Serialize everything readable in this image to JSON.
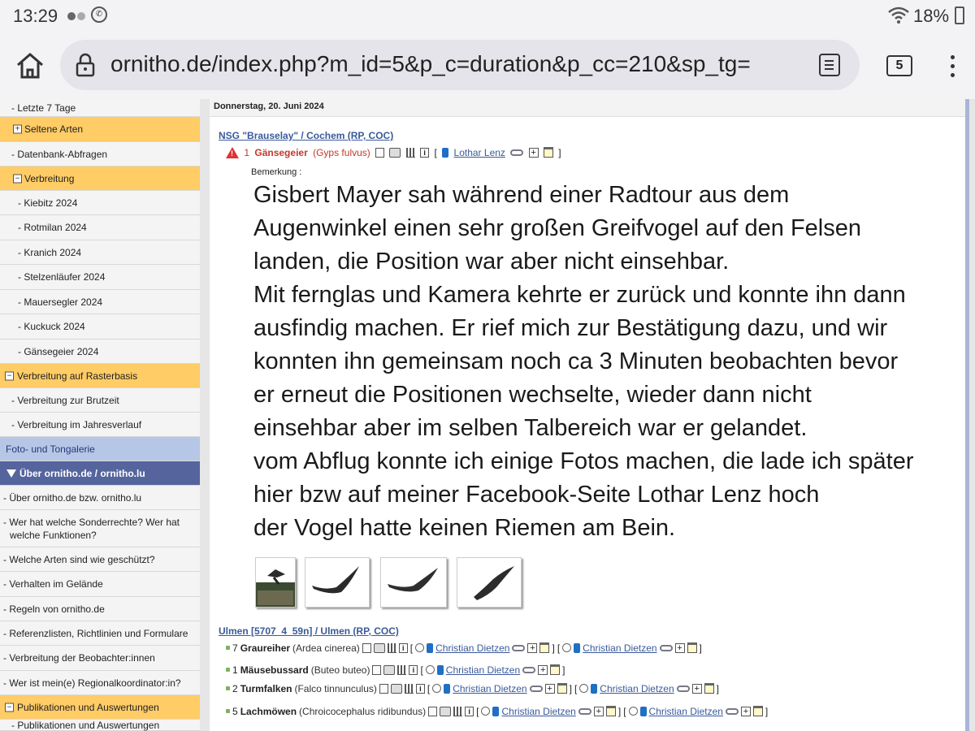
{
  "status": {
    "time": "13:29",
    "battery": "18%",
    "whatsapp_icon": "whatsapp-icon"
  },
  "browser": {
    "url": "ornitho.de/index.php?m_id=5&p_c=duration&p_cc=210&sp_tg=",
    "tab_count": "5"
  },
  "sidebar": {
    "items": [
      {
        "label": "- Letzte 7 Tage",
        "type": "sub"
      },
      {
        "label": "Seltene Arten",
        "type": "cat",
        "box": "+"
      },
      {
        "label": "- Datenbank-Abfragen",
        "type": "sub"
      },
      {
        "label": "Verbreitung",
        "type": "cat",
        "box": "−"
      },
      {
        "label": "- Kiebitz 2024",
        "type": "sub2"
      },
      {
        "label": "- Rotmilan 2024",
        "type": "sub2"
      },
      {
        "label": "- Kranich 2024",
        "type": "sub2"
      },
      {
        "label": "- Stelzenläufer 2024",
        "type": "sub2"
      },
      {
        "label": "- Mauersegler 2024",
        "type": "sub2"
      },
      {
        "label": "- Kuckuck 2024",
        "type": "sub2"
      },
      {
        "label": "- Gänsegeier 2024",
        "type": "sub2"
      },
      {
        "label": "Verbreitung auf Rasterbasis",
        "type": "cat0",
        "box": "−"
      },
      {
        "label": "- Verbreitung zur Brutzeit",
        "type": "sub"
      },
      {
        "label": "- Verbreitung im Jahresverlauf",
        "type": "sub"
      },
      {
        "label": "Foto- und Tongalerie",
        "type": "foto"
      },
      {
        "label": "Über ornitho.de / ornitho.lu",
        "type": "about"
      },
      {
        "label": "- Über ornitho.de bzw. ornitho.lu",
        "type": "sub0"
      },
      {
        "label": "- Wer hat welche Sonderrechte? Wer hat",
        "label2": "welche Funktionen?",
        "type": "sub0"
      },
      {
        "label": "- Welche Arten sind wie geschützt?",
        "type": "sub0"
      },
      {
        "label": "- Verhalten im Gelände",
        "type": "sub0"
      },
      {
        "label": "- Regeln von ornitho.de",
        "type": "sub0"
      },
      {
        "label": "- Referenzlisten, Richtlinien und Formulare",
        "type": "sub0"
      },
      {
        "label": "- Verbreitung der Beobachter:innen",
        "type": "sub0"
      },
      {
        "label": "- Wer ist mein(e) Regionalkoordinator:in?",
        "type": "sub0"
      },
      {
        "label": "Publikationen und Auswertungen",
        "type": "cat0",
        "box": "−"
      },
      {
        "label": "- Publikationen und Auswertungen",
        "type": "sub"
      }
    ]
  },
  "main": {
    "date": "Donnerstag, 20. Juni 2024",
    "location1": "NSG \"Brauselay\" / Cochem (RP, COC)",
    "obs1": {
      "count": "1",
      "species": "Gänsegeier",
      "latin": "(Gyps fulvus)",
      "observer": "Lothar Lenz",
      "open": "[",
      "close": "]"
    },
    "remark_label": "Bemerkung :",
    "remark_lines": [
      "Gisbert Mayer sah während einer Radtour aus dem",
      "Augenwinkel einen sehr großen Greifvogel auf den Felsen",
      "landen, die Position war aber nicht einsehbar.",
      "Mit fernglas und Kamera kehrte er zurück und konnte ihn dann",
      "ausfindig machen. Er rief mich zur Bestätigung dazu, und wir",
      "konnten ihn gemeinsam noch ca 3 Minuten beobachten bevor",
      "er erneut die Positionen wechselte, wieder dann nicht",
      "einsehbar aber im selben Talbereich war er gelandet.",
      "vom Abflug konnte ich einige Fotos machen, die lade ich später",
      "hier bzw auf meiner Facebook-Seite Lothar Lenz hoch",
      "der Vogel hatte keinen Riemen am Bein."
    ],
    "location2": "Ulmen [5707_4_59n] / Ulmen (RP, COC)",
    "obs": [
      {
        "count": "7",
        "species": "Graureiher",
        "latin": "(Ardea cinerea)",
        "observers": [
          "Christian Dietzen",
          "Christian Dietzen"
        ]
      },
      {
        "count": "1",
        "species": "Mäusebussard",
        "latin": "(Buteo buteo)",
        "observers": [
          "Christian Dietzen"
        ]
      },
      {
        "count": "2",
        "species": "Turmfalken",
        "latin": "(Falco tinnunculus)",
        "observers": [
          "Christian Dietzen",
          "Christian Dietzen"
        ]
      },
      {
        "count": "5",
        "species": "Lachmöwen",
        "latin": "(Chroicocephalus ridibundus)",
        "observers": [
          "Christian Dietzen",
          "Christian Dietzen"
        ]
      }
    ]
  },
  "colors": {
    "category": "#ffcc66",
    "about": "#56649e",
    "foto": "#b6c6e6",
    "link": "#3a5a9a",
    "rare": "#c0392b"
  }
}
